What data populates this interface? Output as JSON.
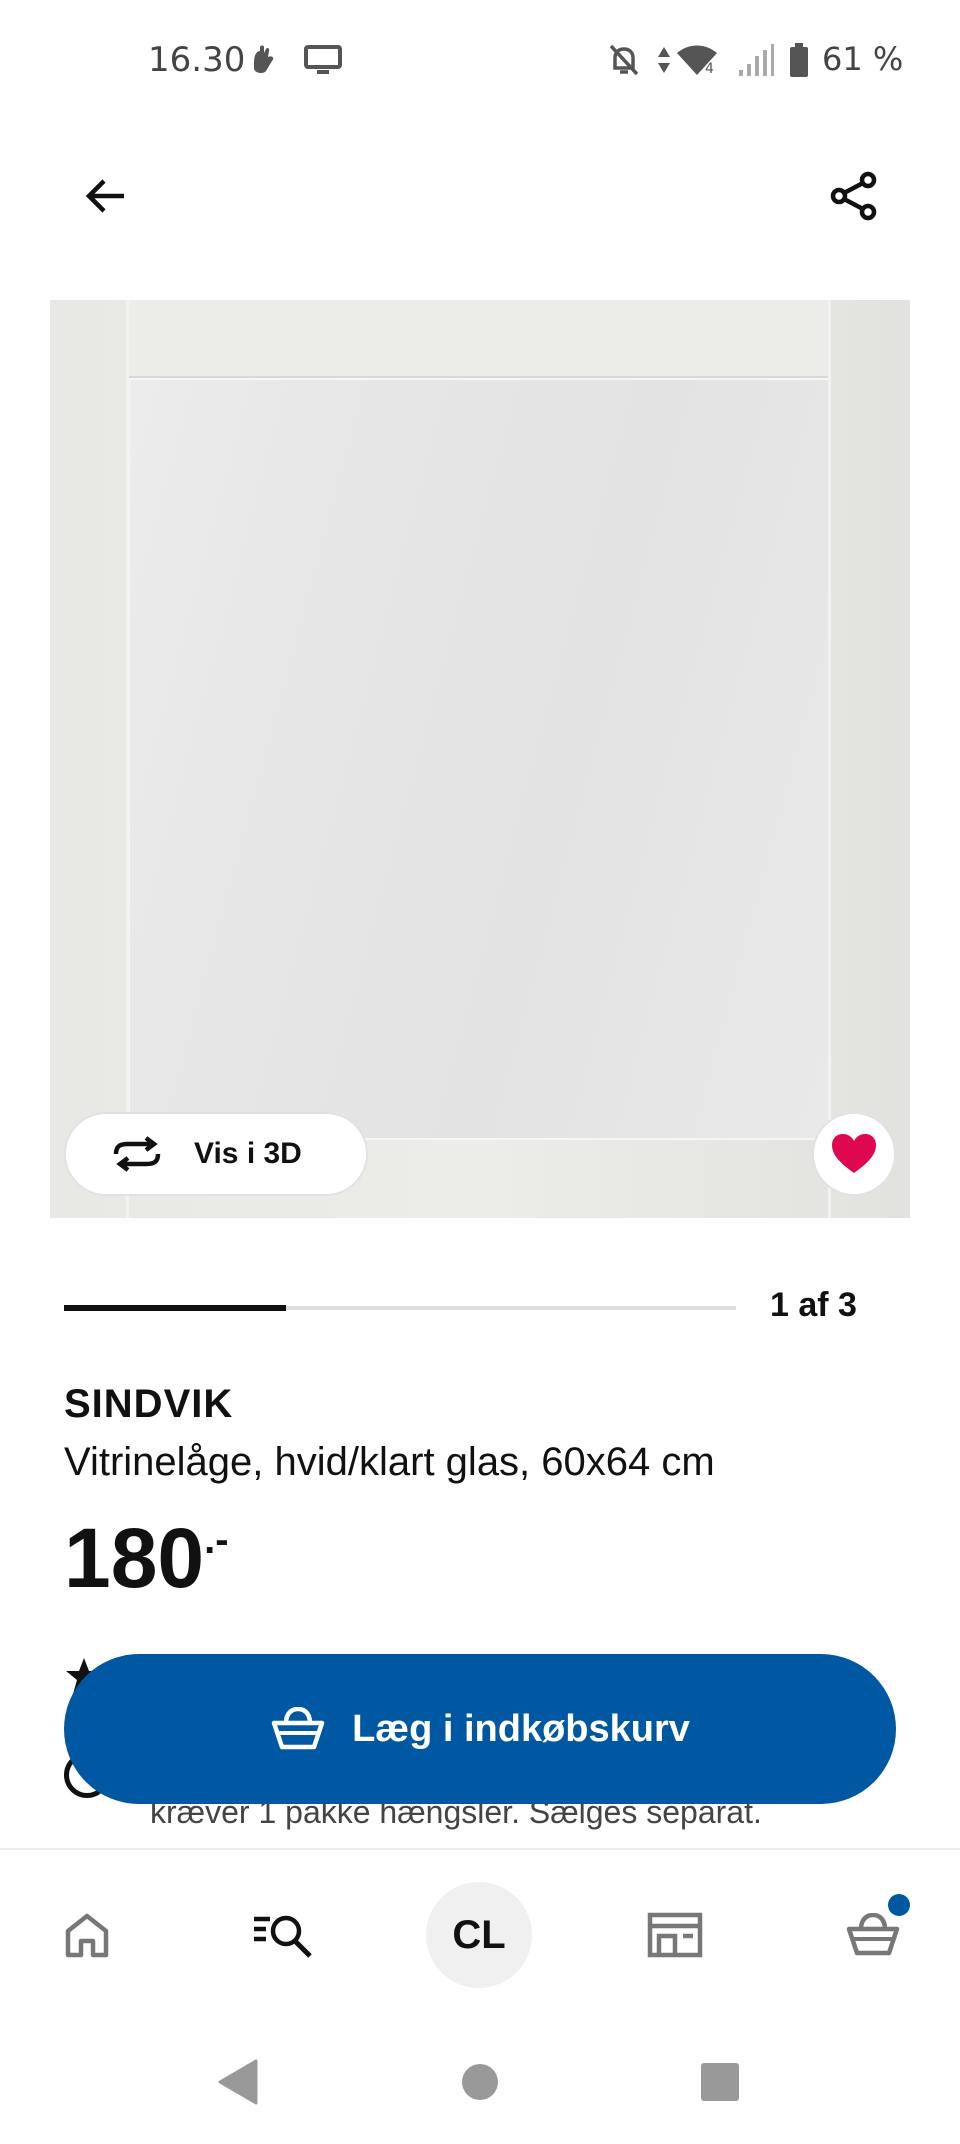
{
  "status_bar": {
    "time": "16.30",
    "battery": "61 %",
    "icons": [
      "hand-icon",
      "screen-cast-icon",
      "bell-off-icon",
      "data-arrows-icon",
      "wifi-icon",
      "cell-signal-icon",
      "battery-icon"
    ],
    "wifi_badge": "4"
  },
  "app_bar": {
    "back_icon": "arrow-left-icon",
    "share_icon": "share-icon"
  },
  "gallery": {
    "view_3d_label": "Vis i 3D",
    "pager_text": "1 af 3",
    "pager_progress": 0.33,
    "favorite_color": "#e00751"
  },
  "product": {
    "name": "SINDVIK",
    "description": "Vitrinelåge, hvid/klart glas, 60x64 cm",
    "price": "180",
    "price_suffix": ".-",
    "partial_info_text": "kræver 1 pakke hængsler. Sælges separat."
  },
  "cta": {
    "add_to_cart_label": "Læg i indkøbskurv",
    "color": "#0058a3"
  },
  "bottom_nav": {
    "items": [
      "home-icon",
      "search-list-icon",
      "profile",
      "store-icon",
      "cart-icon"
    ],
    "profile_initials": "CL"
  }
}
